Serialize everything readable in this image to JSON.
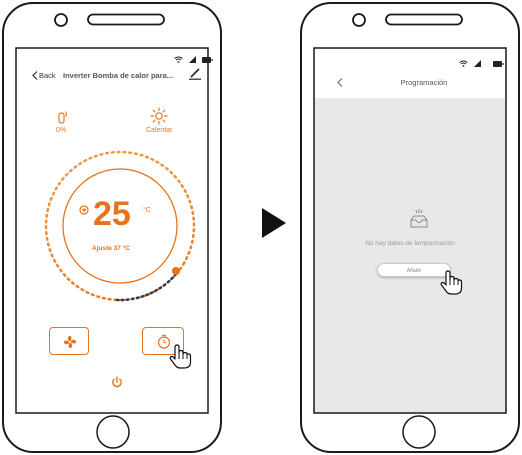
{
  "left_phone": {
    "header": {
      "back_label": "Back",
      "title": "Inverter Bomba de calor para..."
    },
    "humidity": {
      "value": "0%",
      "icon": "water-drop-icon"
    },
    "mode": {
      "label": "Calentar",
      "icon": "sun-icon"
    },
    "temperature": {
      "value": "25",
      "unit": "°C",
      "setpoint": "Ajuste 37 °C"
    }
  },
  "right_phone": {
    "header": {
      "title": "Programación"
    },
    "empty_message": "No hay datos de temporización",
    "add_button_label": "Añadir"
  },
  "colors": {
    "accent": "#e8731c",
    "screen_gray": "#e8e8e8",
    "outline": "#1a1a1a"
  }
}
